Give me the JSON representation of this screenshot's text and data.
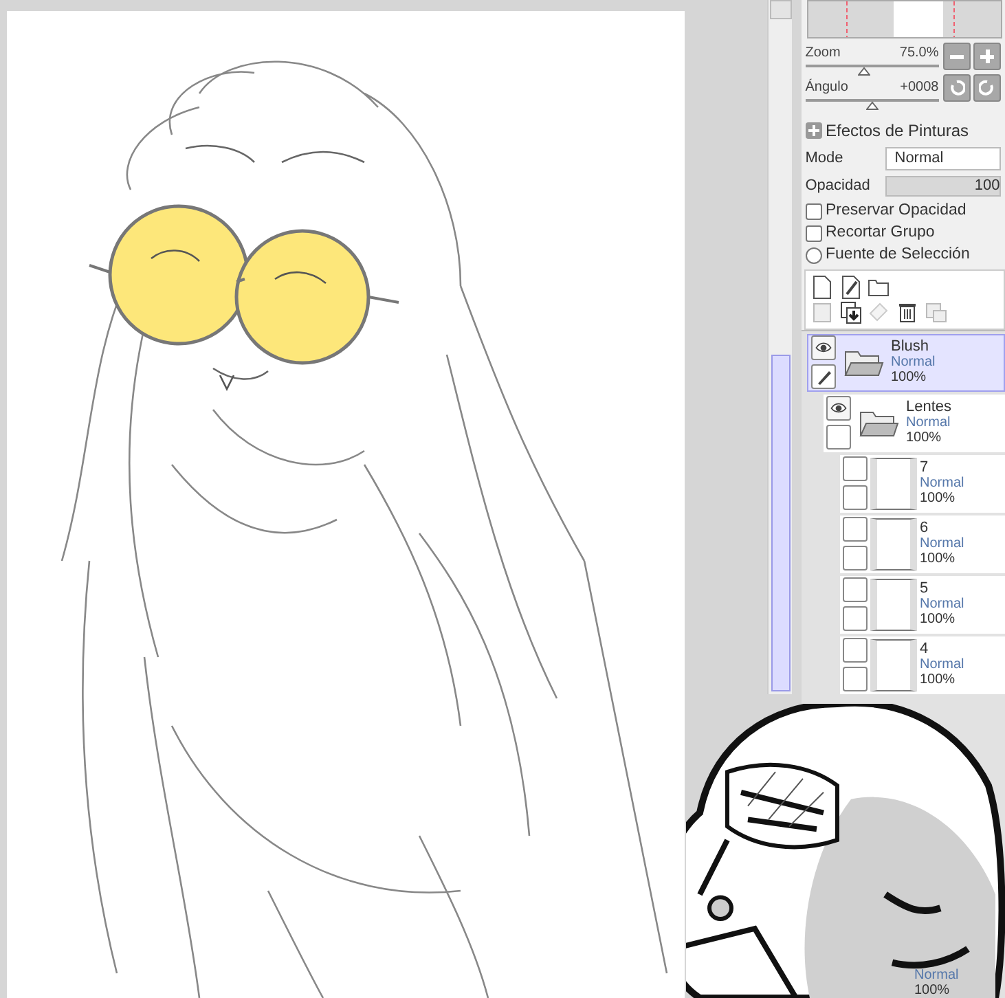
{
  "zoom": {
    "label": "Zoom",
    "value": "75.0%",
    "level": 0.44
  },
  "angle": {
    "label": "Ángulo",
    "value": "+0008",
    "level": 0.5
  },
  "effects": {
    "label": "Efectos de Pinturas"
  },
  "mode": {
    "label": "Mode",
    "value": "Normal"
  },
  "opacity": {
    "label": "Opacidad",
    "value": "100",
    "level": 1
  },
  "options": [
    {
      "kind": "checkbox",
      "label": "Preservar Opacidad",
      "checked": false
    },
    {
      "kind": "checkbox",
      "label": "Recortar Grupo",
      "checked": false
    },
    {
      "kind": "radio",
      "label": "Fuente de Selección",
      "checked": false
    }
  ],
  "layers": [
    {
      "kind": "folder",
      "name": "Blush",
      "mode": "Normal",
      "opacity": "100%",
      "visible": true,
      "selected": true,
      "children": [
        {
          "kind": "folder",
          "name": "Lentes",
          "mode": "Normal",
          "opacity": "100%",
          "visible": true,
          "selected": false,
          "children": [
            {
              "kind": "layer",
              "name": "7",
              "mode": "Normal",
              "opacity": "100%",
              "visible": false,
              "selected": false
            },
            {
              "kind": "layer",
              "name": "6",
              "mode": "Normal",
              "opacity": "100%",
              "visible": false,
              "selected": false
            },
            {
              "kind": "layer",
              "name": "5",
              "mode": "Normal",
              "opacity": "100%",
              "visible": false,
              "selected": false
            },
            {
              "kind": "layer",
              "name": "4",
              "mode": "Normal",
              "opacity": "100%",
              "visible": false,
              "selected": false
            },
            {
              "kind": "partial",
              "mode": "Normal",
              "opacity": "100%"
            }
          ]
        }
      ]
    }
  ]
}
